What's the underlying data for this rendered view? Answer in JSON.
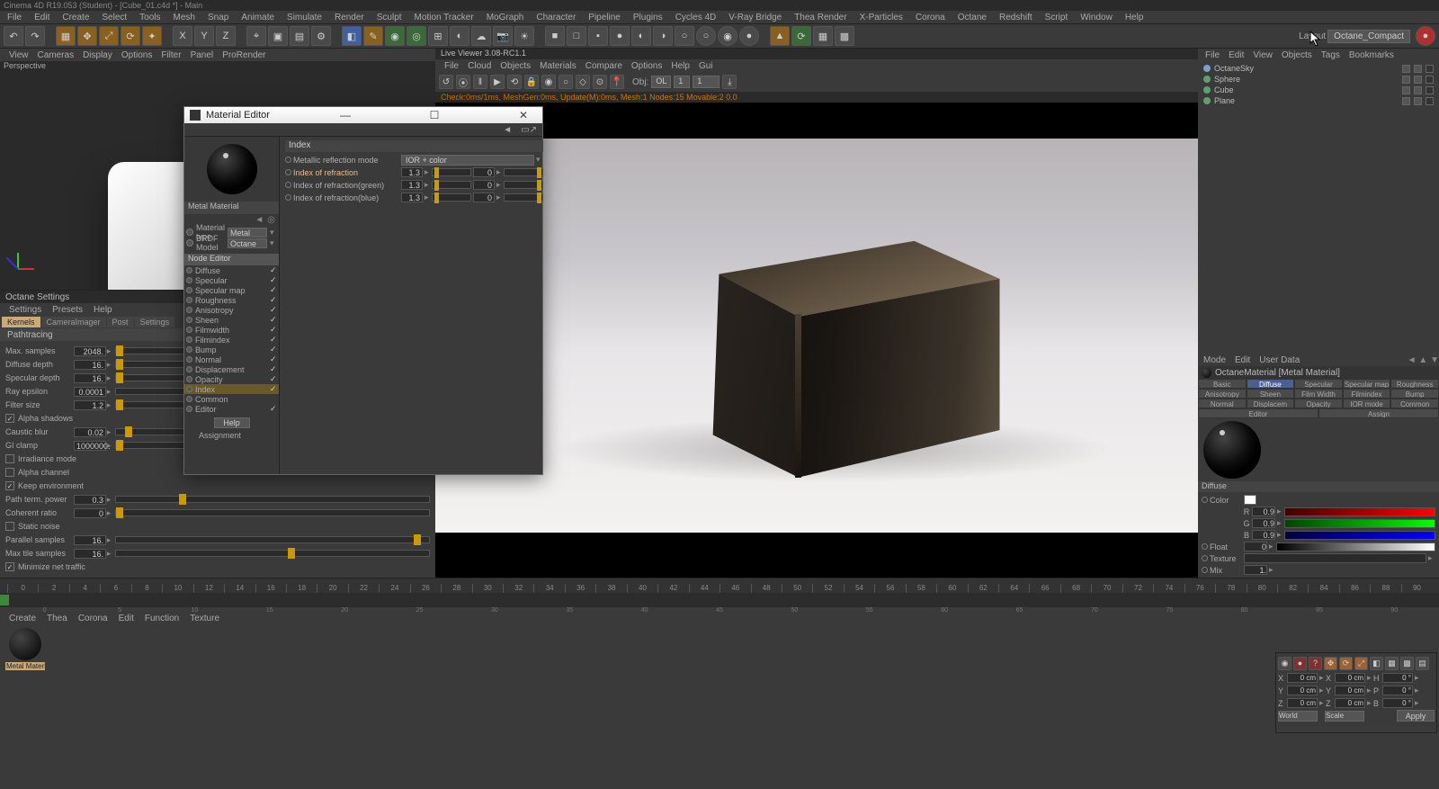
{
  "title": "Cinema 4D R19.053 (Student) - [Cube_01.c4d *] - Main",
  "mainmenu": [
    "File",
    "Edit",
    "Create",
    "Select",
    "Tools",
    "Mesh",
    "Snap",
    "Animate",
    "Simulate",
    "Render",
    "Sculpt",
    "Motion Tracker",
    "MoGraph",
    "Character",
    "Pipeline",
    "Plugins",
    "Cycles 4D",
    "V-Ray Bridge",
    "Thea Render",
    "X-Particles",
    "Corona",
    "Octane",
    "Redshift",
    "Script",
    "Window",
    "Help"
  ],
  "layout_label": "Layout",
  "layout_value": "Octane_Compact",
  "vp_menu": [
    "View",
    "Cameras",
    "Display",
    "Options",
    "Filter",
    "Panel",
    "ProRender"
  ],
  "vp_label": "Perspective",
  "octane_settings": {
    "title": "Octane Settings",
    "menu": [
      "Settings",
      "Presets",
      "Help"
    ],
    "tabs": [
      "Kernels",
      "CameraImager",
      "Post",
      "Settings"
    ],
    "kernel": "Pathtracing",
    "rows": [
      {
        "label": "Max. samples",
        "value": "2048.",
        "pos": 0
      },
      {
        "label": "Diffuse depth",
        "value": "16.",
        "pos": 0
      },
      {
        "label": "Specular depth",
        "value": "16.",
        "pos": 0
      },
      {
        "label": "Ray epsilon",
        "value": "0.0001",
        "pos": 95
      },
      {
        "label": "Filter size",
        "value": "1.2",
        "pos": 0
      }
    ],
    "checks1": [
      {
        "label": "Alpha shadows",
        "on": true
      }
    ],
    "caustic": {
      "label": "Caustic blur",
      "value": "0.02",
      "pos": 3
    },
    "gi": {
      "label": "GI clamp",
      "value": "1000000.",
      "pos": 0
    },
    "checks2": [
      {
        "label": "Irradiance mode",
        "on": false
      },
      {
        "label": "Alpha channel",
        "on": false
      },
      {
        "label": "Keep environment",
        "on": true
      }
    ],
    "path": {
      "label": "Path term. power",
      "value": "0.3",
      "pos": 20
    },
    "coh": {
      "label": "Coherent ratio",
      "value": "0",
      "pos": 0
    },
    "checks3": [
      {
        "label": "Static noise",
        "on": false
      }
    ],
    "par": {
      "label": "Parallel samples",
      "value": "16.",
      "pos": 95
    },
    "tile": {
      "label": "Max tile samples",
      "value": "16.",
      "pos": 55
    },
    "checks4": [
      {
        "label": "Minimize net traffic",
        "on": true
      }
    ]
  },
  "material_editor": {
    "title": "Material Editor",
    "material_name": "Metal Material",
    "type_label": "Material type",
    "type_value": "Metal",
    "brdf_label": "BRDF Model",
    "brdf_value": "Octane",
    "node_editor": "Node Editor",
    "channels": [
      {
        "name": "Diffuse",
        "on": true
      },
      {
        "name": "Specular",
        "on": true
      },
      {
        "name": "Specular map",
        "on": true
      },
      {
        "name": "Roughness",
        "on": true
      },
      {
        "name": "Anisotropy",
        "on": true
      },
      {
        "name": "Sheen",
        "on": true
      },
      {
        "name": "Filmwidth",
        "on": true
      },
      {
        "name": "Filmindex",
        "on": true
      },
      {
        "name": "Bump",
        "on": true
      },
      {
        "name": "Normal",
        "on": true
      },
      {
        "name": "Displacement",
        "on": true
      },
      {
        "name": "Opacity",
        "on": true
      },
      {
        "name": "Index",
        "on": true,
        "hl": true
      },
      {
        "name": "Common",
        "on": false
      },
      {
        "name": "Editor",
        "on": true
      }
    ],
    "help": "Help",
    "assignment": "Assignment",
    "index_head": "Index",
    "mode_label": "Metallic reflection mode",
    "mode_value": "IOR + color",
    "ior_rows": [
      {
        "label": "Index of refraction",
        "v1": "1.3",
        "v2": "0",
        "hl": true
      },
      {
        "label": "Index of refraction(green)",
        "v1": "1.3",
        "v2": "0"
      },
      {
        "label": "Index of refraction(blue)",
        "v1": "1.3",
        "v2": "0"
      }
    ]
  },
  "live_viewer": {
    "title": "Live Viewer 3.08-RC1.1",
    "menu": [
      "File",
      "Cloud",
      "Objects",
      "Materials",
      "Compare",
      "Options",
      "Help",
      "Gui"
    ],
    "obj_label": "Obj:",
    "obj_value": "OL",
    "samp": "1",
    "hdr": "1",
    "status": "Check:0ms/1ms, MeshGen:0ms, Update(M):0ms, Mesh:1 Nodes:15 Movable:2  0.0"
  },
  "obj_manager": {
    "menu": [
      "File",
      "Edit",
      "View",
      "Objects",
      "Tags",
      "Bookmarks"
    ],
    "items": [
      {
        "name": "OctaneSky",
        "color": "#7aa0d0"
      },
      {
        "name": "Sphere",
        "color": "#60a070"
      },
      {
        "name": "Cube",
        "color": "#60a070"
      },
      {
        "name": "Plane",
        "color": "#60a070"
      }
    ]
  },
  "attr": {
    "menu": [
      "Mode",
      "Edit",
      "User Data"
    ],
    "title": "OctaneMaterial [Metal Material]",
    "tabs": [
      "Basic",
      "Diffuse",
      "Specular",
      "Specular map",
      "Roughness",
      "Anisotropy",
      "Sheen",
      "Film Width",
      "Filmindex",
      "Bump",
      "Normal",
      "Displacem",
      "Opacity",
      "IOR mode",
      "Common",
      "Editor",
      "Assign"
    ],
    "active_tab": "Diffuse",
    "section": "Diffuse",
    "color_label": "Color",
    "rgb": [
      {
        "ch": "R",
        "v": "0.9"
      },
      {
        "ch": "G",
        "v": "0.9"
      },
      {
        "ch": "B",
        "v": "0.9"
      }
    ],
    "float_label": "Float",
    "float_v": "0",
    "texture_label": "Texture",
    "mix_label": "Mix",
    "mix_v": "1."
  },
  "timeline": {
    "ticks": [
      "0",
      "2",
      "4",
      "6",
      "8",
      "10",
      "12",
      "14",
      "16",
      "18",
      "20",
      "22",
      "24",
      "26",
      "28",
      "30",
      "32",
      "34",
      "36",
      "38",
      "40",
      "42",
      "44",
      "46",
      "48",
      "50",
      "52",
      "54",
      "56",
      "58",
      "60",
      "62",
      "64",
      "66",
      "68",
      "70",
      "72",
      "74",
      "76",
      "78",
      "80",
      "82",
      "84",
      "86",
      "88",
      "90"
    ],
    "frames": [
      "0",
      "5",
      "10",
      "15",
      "20",
      "25",
      "30",
      "35",
      "40",
      "45",
      "50",
      "55",
      "60",
      "65",
      "70",
      "75",
      "80",
      "85",
      "90"
    ]
  },
  "bottom_menu": [
    "Create",
    "Thea",
    "Corona",
    "Edit",
    "Function",
    "Texture"
  ],
  "shelf": {
    "name": "Metal Material"
  },
  "coord": {
    "rows": [
      {
        "a": "X",
        "av": "0 cm",
        "b": "X",
        "bv": "0 cm",
        "c": "H",
        "cv": "0 °"
      },
      {
        "a": "Y",
        "av": "0 cm",
        "b": "Y",
        "bv": "0 cm",
        "c": "P",
        "cv": "0 °"
      },
      {
        "a": "Z",
        "av": "0 cm",
        "b": "Z",
        "bv": "0 cm",
        "c": "B",
        "cv": "0 °"
      }
    ],
    "sel1": "World",
    "sel2": "Scale",
    "apply": "Apply"
  }
}
